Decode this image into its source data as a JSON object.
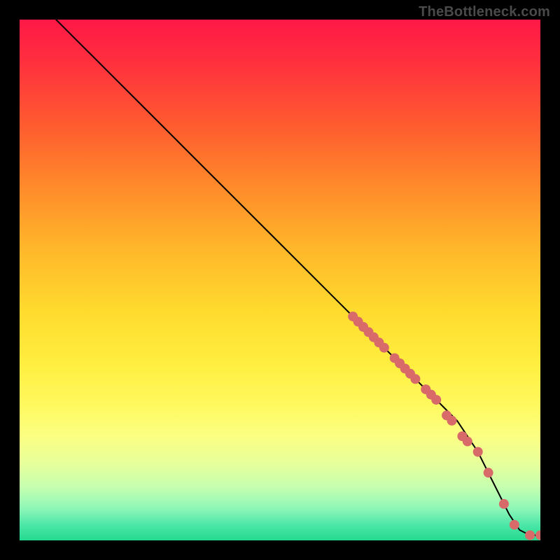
{
  "watermark": "TheBottleneck.com",
  "chart_data": {
    "type": "line",
    "title": "",
    "xlabel": "",
    "ylabel": "",
    "xlim": [
      0,
      100
    ],
    "ylim": [
      0,
      100
    ],
    "grid": false,
    "legend": false,
    "series": [
      {
        "name": "curve",
        "style": "line",
        "color": "#000000",
        "x": [
          7,
          9,
          11,
          14,
          18,
          24,
          30,
          36,
          42,
          48,
          54,
          60,
          64,
          68,
          72,
          76,
          80,
          84,
          88,
          90,
          92,
          94,
          96,
          98,
          100
        ],
        "y": [
          100,
          98,
          96,
          93,
          89,
          83,
          77,
          71,
          65,
          59,
          53,
          47,
          43,
          39,
          35,
          31,
          27,
          23,
          17,
          13,
          9,
          5,
          2,
          1,
          1
        ]
      },
      {
        "name": "points",
        "style": "scatter",
        "color": "#d86a6a",
        "x": [
          64,
          65,
          66,
          67,
          68,
          69,
          70,
          72,
          73,
          74,
          75,
          76,
          78,
          79,
          80,
          82,
          83,
          85,
          86,
          88,
          90,
          93,
          95,
          98,
          100
        ],
        "y": [
          43,
          42,
          41,
          40,
          39,
          38,
          37,
          35,
          34,
          33,
          32,
          31,
          29,
          28,
          27,
          24,
          23,
          20,
          19,
          17,
          13,
          7,
          3,
          1,
          1
        ]
      }
    ]
  }
}
